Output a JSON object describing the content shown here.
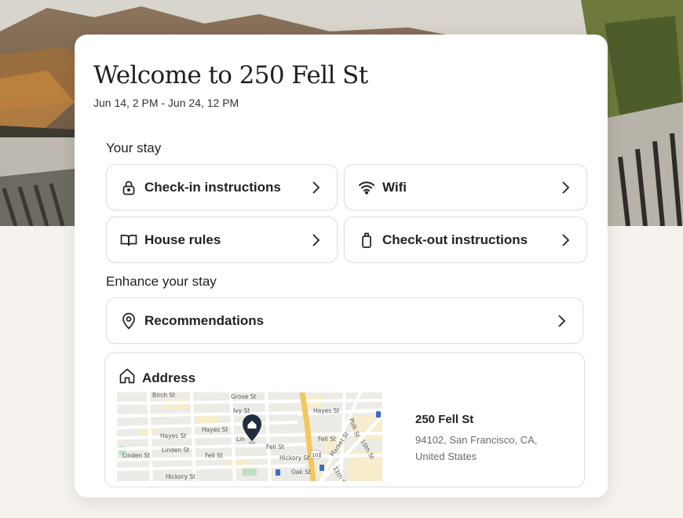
{
  "page": {
    "title": "Welcome to 250 Fell St",
    "dates": "Jun 14, 2 PM - Jun 24, 12 PM"
  },
  "your_stay": {
    "label": "Your stay",
    "tiles": [
      {
        "label": "Check-in instructions",
        "icon": "lock-icon"
      },
      {
        "label": "Wifi",
        "icon": "wifi-icon"
      },
      {
        "label": "House rules",
        "icon": "book-icon"
      },
      {
        "label": "Check-out instructions",
        "icon": "luggage-icon"
      }
    ]
  },
  "enhance": {
    "label": "Enhance your stay",
    "tiles": [
      {
        "label": "Recommendations",
        "icon": "location-pin-icon"
      }
    ]
  },
  "address": {
    "label": "Address",
    "icon": "home-icon",
    "street": "250 Fell St",
    "city_line": "94102, San Francisco, CA, United States",
    "map_labels": [
      "Birch St",
      "Grove St",
      "Ivy St",
      "Hayes St",
      "Hayes St",
      "Hayes St",
      "Linden St",
      "Linden St",
      "Fell St",
      "Fell St",
      "Fell St",
      "Hickory St",
      "Hickory St",
      "Oak St",
      "Polk St",
      "Market St",
      "10th St",
      "11th St",
      "Lin",
      "101"
    ]
  },
  "colors": {
    "accent": "#222222",
    "map_pin": "#1f2f3f",
    "highway": "#f2c760"
  }
}
